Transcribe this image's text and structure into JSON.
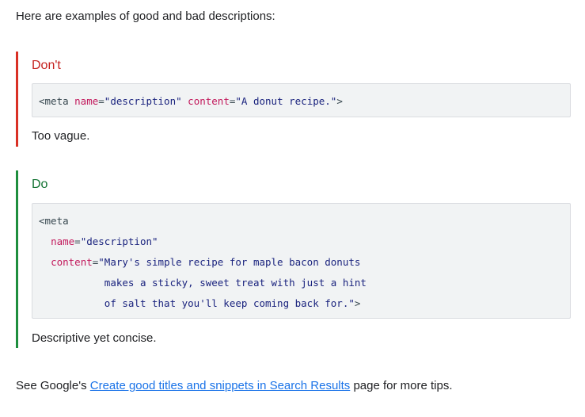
{
  "intro": "Here are examples of good and bad descriptions:",
  "dont": {
    "title": "Don't",
    "code": {
      "open": "<meta ",
      "name_attr": "name",
      "eq1": "=",
      "name_val": "\"description\"",
      "space": " ",
      "content_attr": "content",
      "eq2": "=",
      "content_val": "\"A donut recipe.\"",
      "close": ">"
    },
    "caption": "Too vague."
  },
  "do": {
    "title": "Do",
    "code": {
      "line1": "<meta",
      "name_attr": "name",
      "name_eq": "=",
      "name_val": "\"description\"",
      "content_attr": "content",
      "content_eq": "=",
      "content_val_1": "\"Mary's simple recipe for maple bacon donuts",
      "content_val_2": "makes a sticky, sweet treat with just a hint",
      "content_val_3": "of salt that you'll keep coming back for.\"",
      "close": ">"
    },
    "caption": "Descriptive yet concise."
  },
  "footer": {
    "prefix": "See Google's ",
    "link_text": "Create good titles and snippets in Search Results",
    "suffix": " page for more tips."
  },
  "colors": {
    "dont_accent": "#d93025",
    "do_accent": "#1e8e3e",
    "link": "#1a73e8",
    "attr": "#c2185b",
    "string": "#1a237e"
  }
}
